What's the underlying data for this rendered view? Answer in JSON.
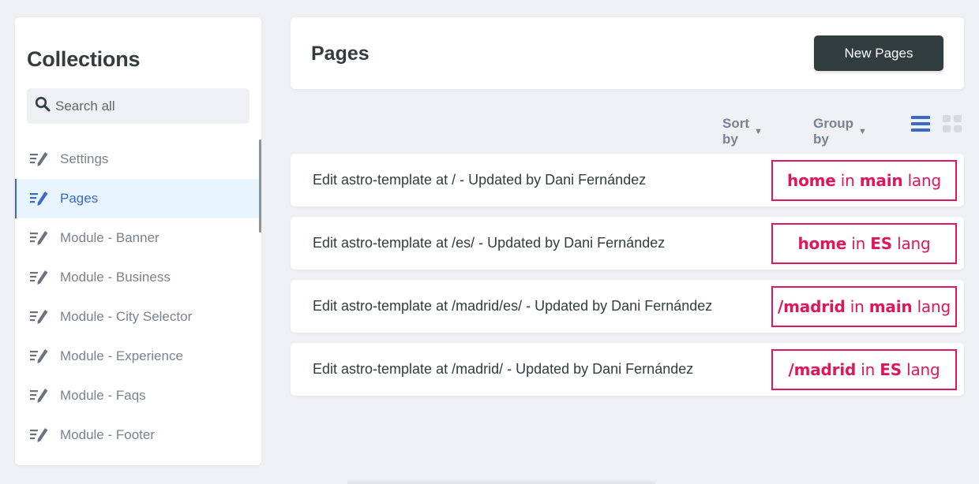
{
  "sidebar": {
    "title": "Collections",
    "search_placeholder": "Search all",
    "items": [
      {
        "label": "Settings",
        "active": false
      },
      {
        "label": "Pages",
        "active": true
      },
      {
        "label": "Module - Banner",
        "active": false
      },
      {
        "label": "Module - Business",
        "active": false
      },
      {
        "label": "Module - City Selector",
        "active": false
      },
      {
        "label": "Module - Experience",
        "active": false
      },
      {
        "label": "Module - Faqs",
        "active": false
      },
      {
        "label": "Module - Footer",
        "active": false
      }
    ]
  },
  "header": {
    "title": "Pages",
    "new_button_label": "New Pages"
  },
  "toolbar": {
    "sort_label": "Sort by",
    "group_label": "Group by",
    "view_mode": "list"
  },
  "entries": [
    {
      "text": "Edit astro-template at / - Updated by Dani Fernández",
      "tag": {
        "subject": "home",
        "mid": " in ",
        "lang": "main",
        "suffix": " lang"
      }
    },
    {
      "text": "Edit astro-template at /es/ - Updated by Dani Fernández",
      "tag": {
        "subject": "home",
        "mid": " in ",
        "lang": "ES",
        "suffix": " lang"
      }
    },
    {
      "text": "Edit astro-template at /madrid/es/ - Updated by Dani Fernández",
      "tag": {
        "subject": "/madrid",
        "mid": " in ",
        "lang": "main",
        "suffix": " lang"
      }
    },
    {
      "text": "Edit astro-template at /madrid/ - Updated by Dani Fernández",
      "tag": {
        "subject": "/madrid",
        "mid": " in ",
        "lang": "ES",
        "suffix": " lang"
      }
    }
  ],
  "colors": {
    "accent": "#3a69c7",
    "annotation": "#e0155a",
    "text_dark": "#313d3e",
    "text_muted": "#798291",
    "background": "#eff0f4"
  },
  "icons": {
    "search": "search-icon",
    "collection": "collection-icon",
    "caret": "caret-down-icon",
    "list_view": "list-view-icon",
    "grid_view": "grid-view-icon"
  }
}
